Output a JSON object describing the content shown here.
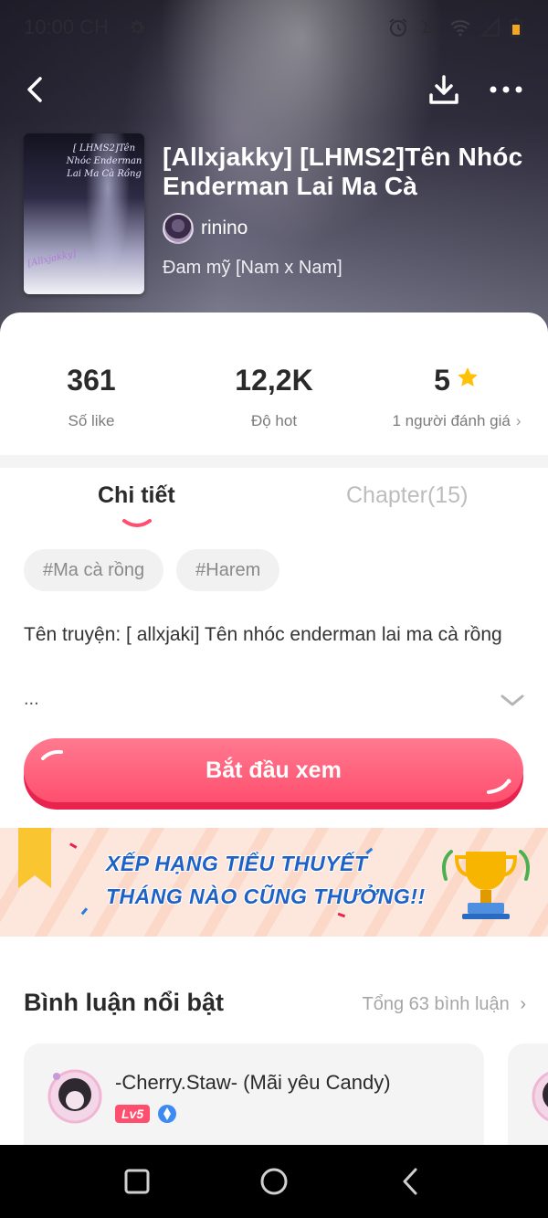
{
  "status": {
    "time": "10:00 CH"
  },
  "book": {
    "title": "[Allxjakky] [LHMS2]Tên Nhóc Enderman Lai Ma Cà",
    "author": "rinino",
    "genre": "Đam mỹ [Nam x Nam]",
    "cover_text": "[ LHMS2]Tên Nhóc Enderman Lai Ma Cà Rồng",
    "cover_signature": "[Allxjakky]"
  },
  "stats": {
    "likes": {
      "value": "361",
      "label": "Số like"
    },
    "hot": {
      "value": "12,2K",
      "label": "Độ hot"
    },
    "rating": {
      "value": "5",
      "label": "1 người đánh giá"
    }
  },
  "tabs": {
    "details": "Chi tiết",
    "chapters": "Chapter(15)"
  },
  "tags": [
    "#Ma cà rồng",
    "#Harem"
  ],
  "description": {
    "text": "Tên truyện: [ allxjaki] Tên nhóc enderman lai ma cà rồng",
    "more": "..."
  },
  "start_button": "Bắt đầu xem",
  "banner": {
    "line1": "XẾP HẠNG TIỂU THUYẾT",
    "line2": "THÁNG NÀO CŨNG THƯỞNG!!"
  },
  "comments": {
    "title": "Bình luận nổi bật",
    "total": "Tổng 63 bình luận",
    "items": [
      {
        "user": "-Cherry.Staw- (Mãi yêu Candy)",
        "level": "Lv5"
      }
    ]
  },
  "colors": {
    "accent": "#ff4f6e",
    "star": "#ffc107",
    "banner_text": "#1e62c7"
  }
}
